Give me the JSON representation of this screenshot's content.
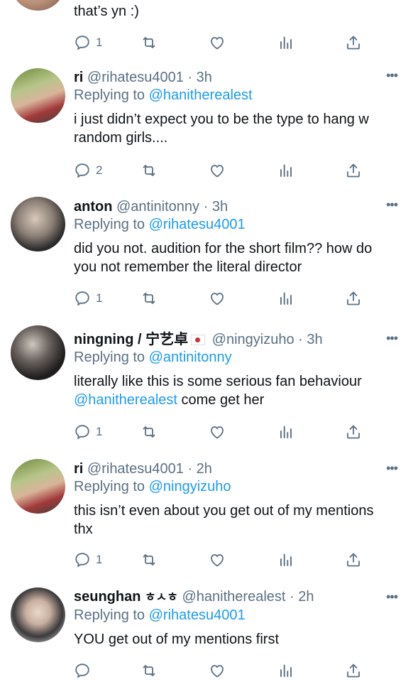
{
  "top": {
    "text": "that’s yn :)",
    "reply_count": "1"
  },
  "tweets": [
    {
      "name": "ri",
      "handle": "@rihatesu4001 · 3h",
      "replying_prefix": "Replying to ",
      "replying_to": "@hanitherealest",
      "text": "i just didn’t expect you to be the type to hang w random girls....",
      "reply_count": "2"
    },
    {
      "name": "anton",
      "handle": "@antinitonny · 3h",
      "replying_prefix": "Replying to ",
      "replying_to": "@rihatesu4001",
      "text": "did you not. audition for the short film?? how do you not remember the literal director",
      "reply_count": "1"
    },
    {
      "name": "ningning / 宁艺卓",
      "handle": "@ningyizuho · 3h",
      "replying_prefix": "Replying to ",
      "replying_to": "@antinitonny",
      "text_part1": "literally like this is some serious fan behaviour ",
      "mention": "@hanitherealest",
      "text_part2": " come get her",
      "reply_count": "1"
    },
    {
      "name": "ri",
      "handle": "@rihatesu4001 · 2h",
      "replying_prefix": "Replying to ",
      "replying_to": "@ningyizuho",
      "text": "this isn’t even about you get out of my mentions thx",
      "reply_count": "1"
    },
    {
      "name": "seunghan",
      "name_extra": "ㅎㅅㅎ",
      "handle": "@hanitherealest · 2h",
      "replying_prefix": "Replying to ",
      "replying_to": "@rihatesu4001",
      "text": "YOU get out of my mentions first",
      "reply_count": ""
    }
  ],
  "icons": {
    "reply": "reply-icon",
    "retweet": "retweet-icon",
    "like": "heart-icon",
    "stats": "stats-icon",
    "share": "share-icon",
    "more": "more-icon"
  },
  "colors": {
    "link": "#1d9bf0",
    "muted": "#5b7083",
    "text": "#0f1419"
  }
}
